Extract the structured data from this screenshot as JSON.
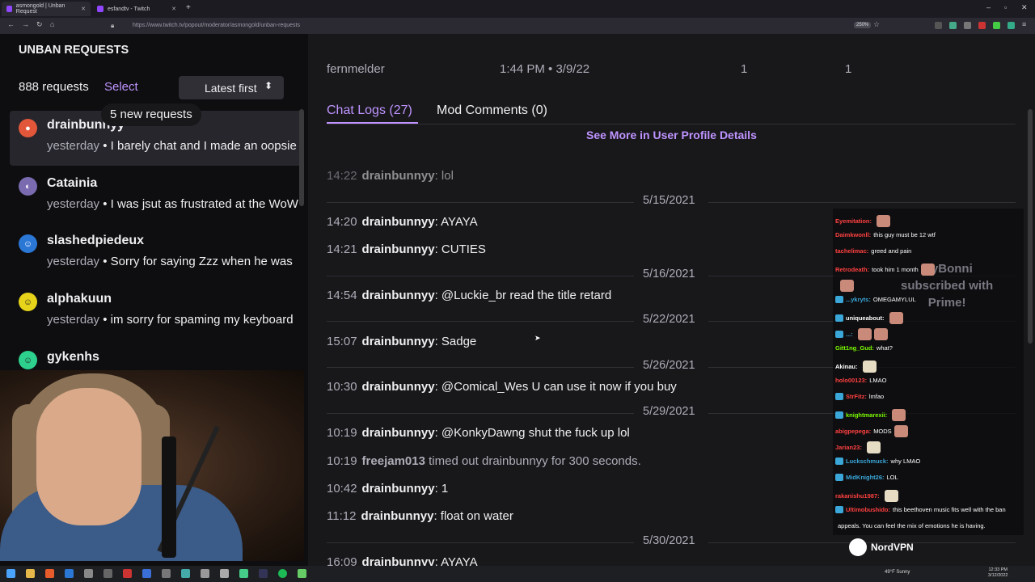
{
  "browser": {
    "tabs": [
      {
        "title": "asmongold | Unban Request"
      },
      {
        "title": "esfandtv - Twitch"
      }
    ],
    "url": "https://www.twitch.tv/popout/moderator/asmongold/unban-requests",
    "zoom": "250%"
  },
  "sidebar": {
    "title": "UNBAN REQUESTS",
    "count": "888 requests",
    "select": "Select",
    "sort": "Latest first",
    "new_requests": "5 new requests",
    "requests": [
      {
        "name": "drainbunnyy",
        "when": "yesterday",
        "message": "• I barely chat and I made an oopsie",
        "avatar_color": "#e2573a"
      },
      {
        "name": "Catainia",
        "when": "yesterday",
        "message": "• I was jsut as frustrated at the WoW",
        "avatar_color": "#7a6bb0"
      },
      {
        "name": "slashedpiedeux",
        "when": "yesterday",
        "message": "• Sorry for saying Zzz when he was",
        "avatar_color": "#2a77d6"
      },
      {
        "name": "alphakuun",
        "when": "yesterday",
        "message": "• im sorry for spaming my keyboard",
        "avatar_color": "#e6d31a"
      },
      {
        "name": "gykenhs",
        "when": "",
        "message": "",
        "avatar_color": "#2dd08d"
      }
    ]
  },
  "details": {
    "header": {
      "user": "fernmelder",
      "time": "1:44 PM • 3/9/22",
      "n1": "1",
      "n2": "1"
    },
    "tabs": {
      "chat_logs": "Chat Logs (27)",
      "mod_comments": "Mod Comments (0)"
    },
    "see_more": "See More in User Profile Details",
    "log": [
      {
        "time": "14:22",
        "user": "drainbunnyy",
        "text": ": lol"
      },
      {
        "date": "5/15/2021"
      },
      {
        "time": "14:20",
        "user": "drainbunnyy",
        "text": ": AYAYA"
      },
      {
        "time": "14:21",
        "user": "drainbunnyy",
        "text": ": CUTIES"
      },
      {
        "date": "5/16/2021"
      },
      {
        "time": "14:54",
        "user": "drainbunnyy",
        "text": ": @Luckie_br read the title retard"
      },
      {
        "date": "5/22/2021"
      },
      {
        "time": "15:07",
        "user": "drainbunnyy",
        "text": ": Sadge"
      },
      {
        "date": "5/26/2021"
      },
      {
        "time": "10:30",
        "user": "drainbunnyy",
        "text": ": @Comical_Wes U can use it now if you buy"
      },
      {
        "date": "5/29/2021"
      },
      {
        "time": "10:19",
        "user": "drainbunnyy",
        "text": ": @KonkyDawng shut the fuck up lol"
      },
      {
        "time": "10:19",
        "user": "freejam013",
        "text": " timed out drainbunnyy for 300 seconds."
      },
      {
        "time": "10:42",
        "user": "drainbunnyy",
        "text": ": 1"
      },
      {
        "time": "11:12",
        "user": "drainbunnyy",
        "text": ": float on water"
      },
      {
        "date": "5/30/2021"
      },
      {
        "time": "16:09",
        "user": "drainbunnyy",
        "text": ": AYAYA"
      }
    ]
  },
  "overlay": {
    "subscribed": [
      "...yBonni",
      "subscribed with",
      "Prime!"
    ],
    "chat": [
      {
        "user": "Eyemitation:",
        "color": "#ff4040",
        "text": ""
      },
      {
        "user": "Daimkwonll:",
        "color": "#ff4040",
        "text": "this guy must be 12 wtf"
      },
      {
        "user": "tachelimac:",
        "color": "#ff4040",
        "text": "greed and pain"
      },
      {
        "user": "Retrodeath:",
        "color": "#ff4040",
        "text": "took him 1 month"
      },
      {
        "user": "",
        "color": "#3aa7d8",
        "text": ""
      },
      {
        "user": "...ykryts:",
        "color": "#3aa7d8",
        "text": "OMEGAMYLUL"
      },
      {
        "user": "uniqueabout:",
        "color": "#ffffff",
        "text": ""
      },
      {
        "user": "...:",
        "color": "#3aa7d8",
        "text": ""
      },
      {
        "user": "Gitt1ng_Gud:",
        "color": "#7cfc00",
        "text": "what?"
      },
      {
        "user": "Akinau:",
        "color": "#ffffff",
        "text": ""
      },
      {
        "user": "holo00123:",
        "color": "#ff4040",
        "text": "LMAO"
      },
      {
        "user": "StrFitz:",
        "color": "#ff4040",
        "text": "lmfao"
      },
      {
        "user": "knightmarexii:",
        "color": "#7cfc00",
        "text": ""
      },
      {
        "user": "abigpepega:",
        "color": "#ff4040",
        "text": "MODS"
      },
      {
        "user": "Jarian23:",
        "color": "#ff4040",
        "text": ""
      },
      {
        "user": "Luckschmuck:",
        "color": "#3aa7d8",
        "text": "why LMAO"
      },
      {
        "user": "MidKnight26:",
        "color": "#3aa7d8",
        "text": "LOL"
      },
      {
        "user": "rakanishu1987:",
        "color": "#ff4040",
        "text": ""
      },
      {
        "user": "Ultimobushido:",
        "color": "#ff4040",
        "text": "this beethoven music fits well with the ban"
      },
      {
        "user": "",
        "color": "#ffffff",
        "text": "appeals. You can feel the mix of emotions he is having."
      }
    ],
    "sponsor": "NordVPN"
  },
  "taskbar": {
    "weather": "49°F Sunny",
    "time": "12:33 PM",
    "date": "3/12/2022"
  }
}
